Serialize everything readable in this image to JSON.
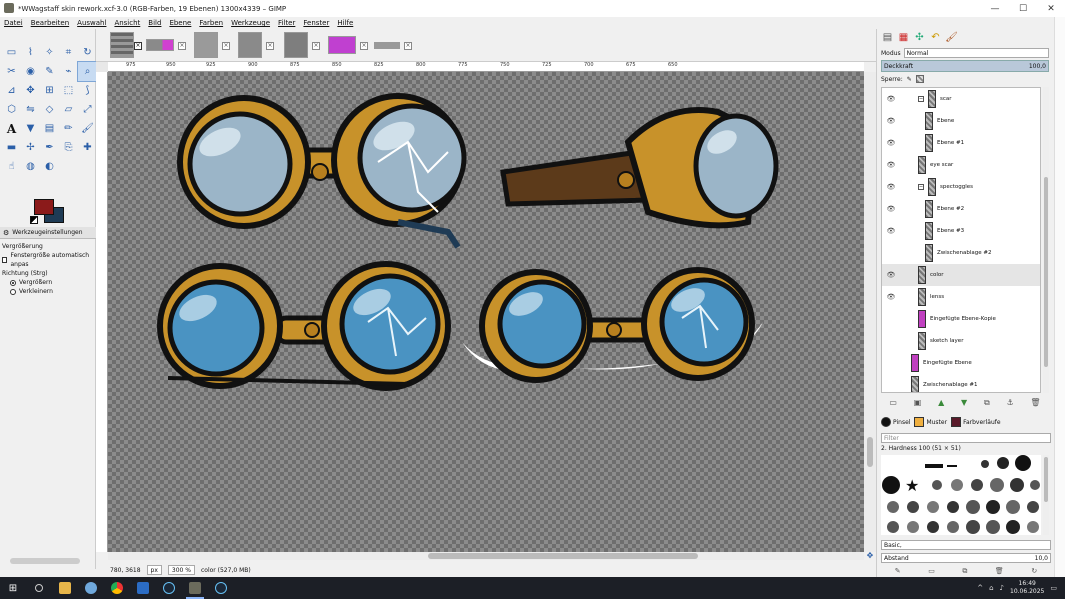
{
  "window": {
    "title": "*WWagstaff skin rework.xcf-3.0 (RGB-Farben, 19 Ebenen) 1300x4339 – GIMP",
    "minimize": "—",
    "maximize": "☐",
    "close": "✕"
  },
  "menu": [
    "Datei",
    "Bearbeiten",
    "Auswahl",
    "Ansicht",
    "Bild",
    "Ebene",
    "Farben",
    "Werkzeuge",
    "Filter",
    "Fenster",
    "Hilfe"
  ],
  "toolbox": {
    "tool_options_tab": "Werkzeugeinstellungen",
    "options_title": "Vergrößerung",
    "auto_resize": "Fenstergröße automatisch anpas",
    "direction_label": "Richtung (Strg)",
    "zoom_in": "Vergrößern",
    "zoom_out": "Verkleinern"
  },
  "ruler": {
    "marks": [
      "975",
      "950",
      "925",
      "900",
      "875",
      "850",
      "825",
      "800",
      "775",
      "750",
      "725",
      "700",
      "675",
      "650"
    ]
  },
  "status": {
    "coords": "780, 3618",
    "unit": "px",
    "zoom": "300 %",
    "info": "color (527,0 MB)"
  },
  "dock": {
    "mode_label": "Modus",
    "mode_value": "Normal",
    "opacity_label": "Deckkraft",
    "opacity_value": "100,0",
    "lock_label": "Sperre:",
    "layers": [
      {
        "name": "scar",
        "indent": 2,
        "type": "group",
        "visible": true
      },
      {
        "name": "Ebene",
        "indent": 3,
        "type": "layer",
        "visible": true
      },
      {
        "name": "Ebene #1",
        "indent": 3,
        "type": "layer",
        "visible": true
      },
      {
        "name": "eye scar",
        "indent": 2,
        "type": "layer",
        "visible": true
      },
      {
        "name": "spectoggles",
        "indent": 2,
        "type": "group",
        "visible": true
      },
      {
        "name": "Ebene #2",
        "indent": 3,
        "type": "layer",
        "visible": true
      },
      {
        "name": "Ebene #3",
        "indent": 3,
        "type": "layer",
        "visible": true
      },
      {
        "name": "Zwischenablage #2",
        "indent": 3,
        "type": "layer",
        "visible": false
      },
      {
        "name": "color",
        "indent": 2,
        "type": "layer",
        "visible": true,
        "selected": true
      },
      {
        "name": "lenss",
        "indent": 2,
        "type": "layer",
        "visible": true
      },
      {
        "name": "Eingefügte Ebene-Kopie",
        "indent": 2,
        "type": "magenta",
        "visible": false
      },
      {
        "name": "sketch layer",
        "indent": 2,
        "type": "layer",
        "visible": false
      },
      {
        "name": "Eingefügte Ebene",
        "indent": 1,
        "type": "magenta",
        "visible": false
      },
      {
        "name": "Zwischenablage #1",
        "indent": 1,
        "type": "layer",
        "visible": false
      }
    ],
    "brush_tabs": [
      "Pinsel",
      "Muster",
      "Farbverläufe"
    ],
    "filter_placeholder": "Filter",
    "brush_name": "2. Hardness 100 (51 × 51)",
    "preset": "Basic,",
    "spacing_label": "Abstand",
    "spacing_value": "10,0"
  },
  "taskbar": {
    "time": "16:49",
    "date": "10.06.2025"
  },
  "colors": {
    "foreground": "#8b1a1a",
    "background": "#1f3b55",
    "accent": "#c7dbf2"
  }
}
